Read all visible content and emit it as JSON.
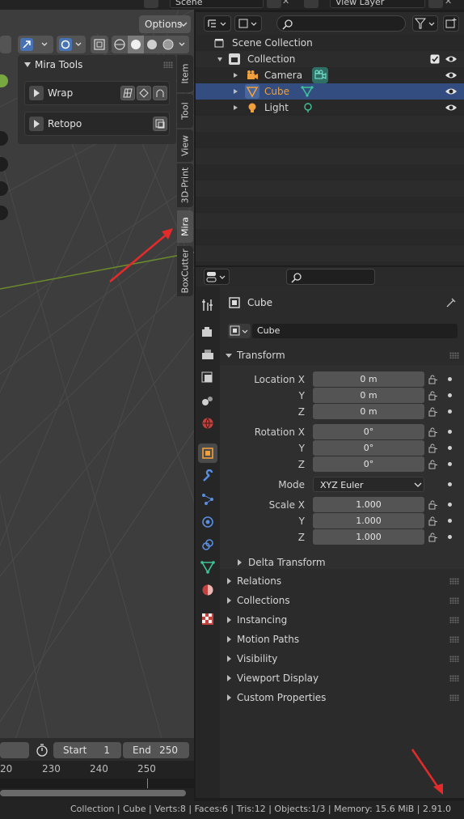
{
  "topbar": {
    "scene": "Scene",
    "view_layer": "View Layer"
  },
  "viewport": {
    "options_label": "Options",
    "tabs": [
      "Item",
      "Tool",
      "View",
      "3D-Print",
      "Mira",
      "BoxCutter"
    ],
    "active_tab": "Mira",
    "mira_panel": {
      "title": "Mira Tools",
      "rows": [
        "Wrap",
        "Retopo"
      ]
    }
  },
  "outliner": {
    "items": [
      {
        "label": "Scene Collection"
      },
      {
        "label": "Collection"
      },
      {
        "label": "Camera"
      },
      {
        "label": "Cube"
      },
      {
        "label": "Light"
      }
    ],
    "selected": "Cube"
  },
  "properties": {
    "object_name": "Cube",
    "object_field": "Cube",
    "transform_title": "Transform",
    "location": {
      "label_x": "Location X",
      "label_y": "Y",
      "label_z": "Z",
      "x": "0 m",
      "y": "0 m",
      "z": "0 m"
    },
    "rotation": {
      "label_x": "Rotation X",
      "label_y": "Y",
      "label_z": "Z",
      "x": "0°",
      "y": "0°",
      "z": "0°"
    },
    "mode": {
      "label": "Mode",
      "value": "XYZ Euler"
    },
    "scale": {
      "label_x": "Scale X",
      "label_y": "Y",
      "label_z": "Z",
      "x": "1.000",
      "y": "1.000",
      "z": "1.000"
    },
    "delta_transform": "Delta Transform",
    "sections": [
      "Relations",
      "Collections",
      "Instancing",
      "Motion Paths",
      "Visibility",
      "Viewport Display",
      "Custom Properties"
    ]
  },
  "timeline": {
    "start_label": "Start",
    "start_value": "1",
    "end_label": "End",
    "end_value": "250",
    "ticks": [
      "20",
      "230",
      "240",
      "250"
    ]
  },
  "statusbar": {
    "text": "Collection | Cube | Verts:8 | Faces:6 | Tris:12 | Objects:1/3 | Memory: 15.6 MiB | 2.91.0"
  },
  "colors": {
    "selection": "#334d80",
    "accent_orange": "#f0a03c",
    "mesh_green": "#3fc39a",
    "annotation_arrow": "#e32b2b"
  }
}
